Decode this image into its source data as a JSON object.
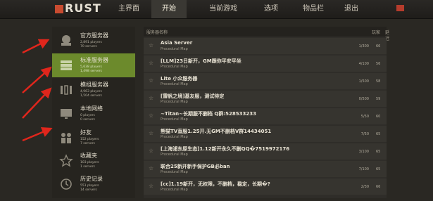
{
  "topbar": {
    "logo_text": "RUST",
    "nav": [
      {
        "label": "主界面",
        "active": false
      },
      {
        "label": "开始",
        "active": true
      },
      {
        "label": "当前游戏",
        "active": false
      },
      {
        "label": "选项",
        "active": false
      },
      {
        "label": "物品栏",
        "active": false
      },
      {
        "label": "退出",
        "active": false
      }
    ]
  },
  "sidebar": {
    "items": [
      {
        "label": "官方服务器",
        "sub1": "2,891 players",
        "sub2": "70 servers",
        "icon": "official-icon",
        "active": false
      },
      {
        "label": "标准服务器",
        "sub1": "5,638 players",
        "sub2": "1,498 servers",
        "icon": "server-rack-icon",
        "active": true
      },
      {
        "label": "模组服务器",
        "sub1": "4,963 players",
        "sub2": "1,504 servers",
        "icon": "modded-icon",
        "active": false
      },
      {
        "label": "本地网络",
        "sub1": "0 players",
        "sub2": "0 servers",
        "icon": "monitor-icon",
        "active": false
      },
      {
        "label": "好友",
        "sub1": "152 players",
        "sub2": "7 servers",
        "icon": "friends-icon",
        "active": false
      },
      {
        "label": "收藏夹",
        "sub1": "103 players",
        "sub2": "1 servers",
        "icon": "star-icon",
        "active": false
      },
      {
        "label": "历史记录",
        "sub1": "551 players",
        "sub2": "14 servers",
        "icon": "history-icon",
        "active": false
      }
    ]
  },
  "server_list": {
    "headers": {
      "name": "服务器名称",
      "players": "玩家",
      "ping": "延迟"
    },
    "rows": [
      {
        "name": "Asia Server",
        "map": "Procedural Map",
        "players": "1/300",
        "ping": "66"
      },
      {
        "name": "[LLM]23日新开，GM跟你平安平坐",
        "map": "Procedural Map",
        "players": "4/100",
        "ping": "56"
      },
      {
        "name": "Lite 小众服务器",
        "map": "Procedural Map",
        "players": "1/500",
        "ping": "58"
      },
      {
        "name": "[雷帆之境]基友服，测试待定",
        "map": "Procedural Map",
        "players": "0/500",
        "ping": "59"
      },
      {
        "name": "~Titan~长期服不删档 Q群:528533233",
        "map": "Procedural Map",
        "players": "5/50",
        "ping": "60"
      },
      {
        "name": "熊猫TV直服1.25开.无GM不删档V群14434051",
        "map": "Procedural Map",
        "players": "7/50",
        "ping": "65"
      },
      {
        "name": "[上海浦东原生态]1.12新开永久不删QQ�7519972176",
        "map": "Procedural Map",
        "players": "3/100",
        "ping": "65"
      },
      {
        "name": "联合25新开新手保护GB必ban",
        "map": "Procedural Map",
        "players": "7/100",
        "ping": "65"
      },
      {
        "name": "[cc]1.19新开，无权限，不删档，稳定，长期�?",
        "map": "Procedural Map",
        "players": "2/30",
        "ping": "66"
      }
    ]
  },
  "colors": {
    "accent_green": "#6c8a2c",
    "arrow_red": "#e0261c",
    "logo_red": "#c94b30"
  }
}
